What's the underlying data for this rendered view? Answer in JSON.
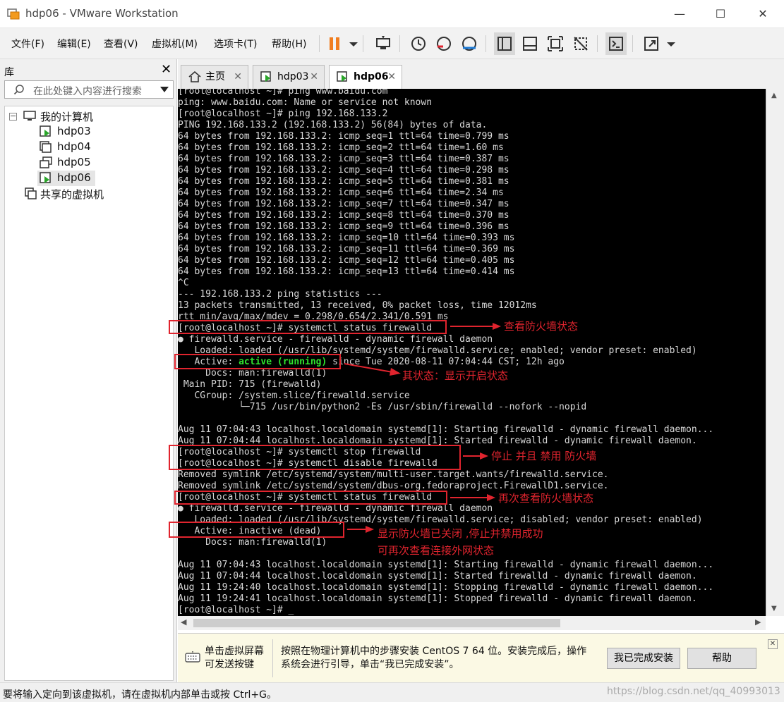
{
  "window": {
    "title": "hdp06 - VMware Workstation",
    "min": "—",
    "max": "☐",
    "close": "✕"
  },
  "menu": [
    "文件(F)",
    "编辑(E)",
    "查看(V)",
    "虚拟机(M)",
    "选项卡(T)",
    "帮助(H)"
  ],
  "library": {
    "title": "库",
    "close": "✕",
    "search_placeholder": "在此处键入内容进行搜索",
    "tree": {
      "root": "我的计算机",
      "vms": [
        "hdp03",
        "hdp04",
        "hdp05",
        "hdp06"
      ],
      "shared": "共享的虚拟机"
    }
  },
  "tabs": [
    {
      "label": "主页"
    },
    {
      "label": "hdp03"
    },
    {
      "label": "hdp06"
    }
  ],
  "terminal": {
    "lines_a": [
      "[root@localhost ~]# ping www.baidu.com",
      "ping: www.baidu.com: Name or service not known",
      "[root@localhost ~]# ping 192.168.133.2",
      "PING 192.168.133.2 (192.168.133.2) 56(84) bytes of data.",
      "64 bytes from 192.168.133.2: icmp_seq=1 ttl=64 time=0.799 ms",
      "64 bytes from 192.168.133.2: icmp_seq=2 ttl=64 time=1.60 ms",
      "64 bytes from 192.168.133.2: icmp_seq=3 ttl=64 time=0.387 ms",
      "64 bytes from 192.168.133.2: icmp_seq=4 ttl=64 time=0.298 ms",
      "64 bytes from 192.168.133.2: icmp_seq=5 ttl=64 time=0.381 ms",
      "64 bytes from 192.168.133.2: icmp_seq=6 ttl=64 time=2.34 ms",
      "64 bytes from 192.168.133.2: icmp_seq=7 ttl=64 time=0.347 ms",
      "64 bytes from 192.168.133.2: icmp_seq=8 ttl=64 time=0.370 ms",
      "64 bytes from 192.168.133.2: icmp_seq=9 ttl=64 time=0.396 ms",
      "64 bytes from 192.168.133.2: icmp_seq=10 ttl=64 time=0.393 ms",
      "64 bytes from 192.168.133.2: icmp_seq=11 ttl=64 time=0.369 ms",
      "64 bytes from 192.168.133.2: icmp_seq=12 ttl=64 time=0.405 ms",
      "64 bytes from 192.168.133.2: icmp_seq=13 ttl=64 time=0.414 ms",
      "^C",
      "--- 192.168.133.2 ping statistics ---",
      "13 packets transmitted, 13 received, 0% packet loss, time 12012ms",
      "rtt min/avg/max/mdev = 0.298/0.654/2.341/0.591 ms",
      "[root@localhost ~]# systemctl status firewalld",
      "● firewalld.service - firewalld - dynamic firewall daemon",
      "   Loaded: loaded (/usr/lib/systemd/system/firewalld.service; enabled; vendor preset: enabled)"
    ],
    "active1_prefix": "   Active: ",
    "active1_status": "active (running)",
    "active1_suffix": " since Tue 2020-08-11 07:04:44 CST; 12h ago",
    "lines_b": [
      "     Docs: man:firewalld(1)",
      " Main PID: 715 (firewalld)",
      "   CGroup: /system.slice/firewalld.service",
      "           └─715 /usr/bin/python2 -Es /usr/sbin/firewalld --nofork --nopid",
      "",
      "Aug 11 07:04:43 localhost.localdomain systemd[1]: Starting firewalld - dynamic firewall daemon...",
      "Aug 11 07:04:44 localhost.localdomain systemd[1]: Started firewalld - dynamic firewall daemon.",
      "[root@localhost ~]# systemctl stop firewalld",
      "[root@localhost ~]# systemctl disable firewalld",
      "Removed symlink /etc/systemd/system/multi-user.target.wants/firewalld.service.",
      "Removed symlink /etc/systemd/system/dbus-org.fedoraproject.FirewallD1.service.",
      "[root@localhost ~]# systemctl status firewalld",
      "● firewalld.service - firewalld - dynamic firewall daemon",
      "   Loaded: loaded (/usr/lib/systemd/system/firewalld.service; disabled; vendor preset: enabled)",
      "   Active: inactive (dead)",
      "     Docs: man:firewalld(1)",
      "",
      "Aug 11 07:04:43 localhost.localdomain systemd[1]: Starting firewalld - dynamic firewall daemon...",
      "Aug 11 07:04:44 localhost.localdomain systemd[1]: Started firewalld - dynamic firewall daemon.",
      "Aug 11 19:24:40 localhost.localdomain systemd[1]: Stopping firewalld - dynamic firewall daemon...",
      "Aug 11 19:24:41 localhost.localdomain systemd[1]: Stopped firewalld - dynamic firewall daemon.",
      "[root@localhost ~]# _"
    ]
  },
  "annotations": {
    "a1": "查看防火墙状态",
    "a2": "其状态：显示开启状态",
    "a3": "停止 并且 禁用 防火墙",
    "a4": "再次查看防火墙状态",
    "a5_line1": "显示防火墙已关闭 ,停止并禁用成功",
    "a5_line2": "可再次查看连接外网状态",
    "color": "#e0242e"
  },
  "infobar": {
    "left_line1": "单击虚拟屏幕",
    "left_line2": "可发送按键",
    "msg_line1": "按照在物理计算机中的步骤安装 CentOS 7 64 位。安装完成后，操作",
    "msg_line2": "系统会进行引导，单击“我已完成安装”。",
    "done_button": "我已完成安装",
    "help_button": "帮助",
    "close": "✕"
  },
  "status": {
    "text": "要将输入定向到该虚拟机，请在虚拟机内部单击或按 Ctrl+G。",
    "watermark": "https://blog.csdn.net/qq_40993013"
  }
}
